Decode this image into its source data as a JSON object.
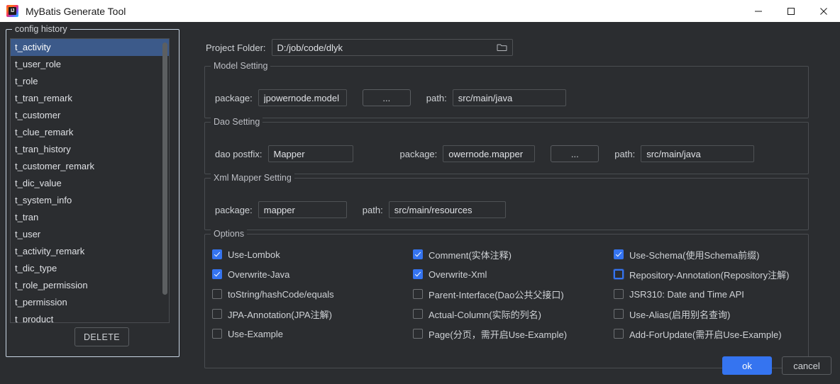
{
  "window": {
    "title": "MyBatis Generate Tool",
    "icon": "intellij-idea-icon",
    "icon_text": "IJ",
    "minimize_label": "Minimize",
    "maximize_label": "Maximize",
    "close_label": "Close"
  },
  "config_history": {
    "legend": "config history",
    "items": [
      "t_activity",
      "t_user_role",
      "t_role",
      "t_tran_remark",
      "t_customer",
      "t_clue_remark",
      "t_tran_history",
      "t_customer_remark",
      "t_dic_value",
      "t_system_info",
      "t_tran",
      "t_user",
      "t_activity_remark",
      "t_dic_type",
      "t_role_permission",
      "t_permission",
      "t_product"
    ],
    "selected_index": 0,
    "delete_label": "DELETE"
  },
  "project_folder": {
    "label": "Project Folder:",
    "value": "D:/job/code/dlyk",
    "browse_icon": "folder-icon"
  },
  "model_setting": {
    "legend": "Model Setting",
    "package_label": "package:",
    "package_value": "jpowernode.model",
    "browse_label": "...",
    "path_label": "path:",
    "path_value": "src/main/java"
  },
  "dao_setting": {
    "legend": "Dao Setting",
    "postfix_label": "dao postfix:",
    "postfix_value": "Mapper",
    "package_label": "package:",
    "package_value": "owernode.mapper",
    "browse_label": "...",
    "path_label": "path:",
    "path_value": "src/main/java"
  },
  "xml_setting": {
    "legend": "Xml Mapper Setting",
    "package_label": "package:",
    "package_value": "mapper",
    "path_label": "path:",
    "path_value": "src/main/resources"
  },
  "options": {
    "legend": "Options",
    "items": [
      {
        "label": "Use-Lombok",
        "checked": true,
        "focused": false
      },
      {
        "label": "Comment(实体注释)",
        "checked": true,
        "focused": false
      },
      {
        "label": "Use-Schema(使用Schema前缀)",
        "checked": true,
        "focused": false
      },
      {
        "label": "Overwrite-Java",
        "checked": true,
        "focused": false
      },
      {
        "label": "Overwrite-Xml",
        "checked": true,
        "focused": false
      },
      {
        "label": "Repository-Annotation(Repository注解)",
        "checked": false,
        "focused": true
      },
      {
        "label": "toString/hashCode/equals",
        "checked": false,
        "focused": false
      },
      {
        "label": "Parent-Interface(Dao公共父接口)",
        "checked": false,
        "focused": false
      },
      {
        "label": "JSR310: Date and Time API",
        "checked": false,
        "focused": false
      },
      {
        "label": "JPA-Annotation(JPA注解)",
        "checked": false,
        "focused": false
      },
      {
        "label": "Actual-Column(实际的列名)",
        "checked": false,
        "focused": false
      },
      {
        "label": "Use-Alias(启用别名查询)",
        "checked": false,
        "focused": false
      },
      {
        "label": "Use-Example",
        "checked": false,
        "focused": false
      },
      {
        "label": "Page(分页，需开启Use-Example)",
        "checked": false,
        "focused": false
      },
      {
        "label": "Add-ForUpdate(需开启Use-Example)",
        "checked": false,
        "focused": false
      }
    ]
  },
  "footer": {
    "ok_label": "ok",
    "cancel_label": "cancel"
  },
  "colors": {
    "accent": "#3574f0",
    "selection": "#3c5a8a",
    "background": "#2b2d30",
    "titlebar": "#ffffff"
  }
}
